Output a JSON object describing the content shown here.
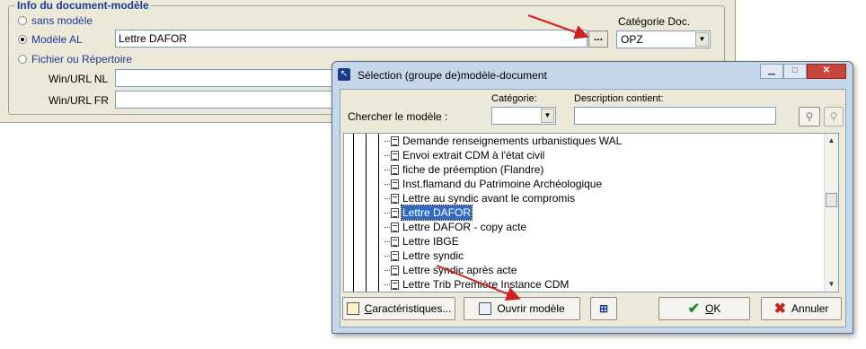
{
  "background_form": {
    "group_title": "Info du document-modèle",
    "radio_sans_modele": "sans modèle",
    "radio_modele_al": "Modèle AL",
    "radio_fichier": "Fichier ou Répertoire",
    "modele_value": "Lettre DAFOR",
    "browse_label": "...",
    "categorie_label": "Catégorie Doc.",
    "categorie_value": "OPZ",
    "win_url_nl_label": "Win/URL NL",
    "win_url_fr_label": "Win/URL FR"
  },
  "dialog": {
    "title": "Sélection (groupe de)modèle-document",
    "search_label": "Chercher le modèle :",
    "categorie_label": "Catégorie:",
    "description_label": "Description contient:",
    "items": [
      "Demande renseignements urbanistiques WAL",
      "Envoi extrait CDM à l'état civil",
      "fiche de préemption (Flandre)",
      "Inst.flamand du Patrimoine Archéologique",
      "Lettre au syndic avant le compromis",
      "Lettre DAFOR",
      "Lettre DAFOR - copy acte",
      "Lettre IBGE",
      "Lettre syndic",
      "Lettre syndic après acte",
      "Lettre Trib Première Instance CDM"
    ],
    "selected_index": 5,
    "btn_caracteristiques_u": "C",
    "btn_caracteristiques_rest": "aractéristiques...",
    "btn_ouvrir": "Ouvrir modèle",
    "btn_ok_u": "O",
    "btn_ok_rest": "K",
    "btn_annuler": "Annuler"
  },
  "colors": {
    "selection": "#316ac5",
    "annotation_arrow": "#d01f1f",
    "label_blue": "#1c3a94"
  }
}
